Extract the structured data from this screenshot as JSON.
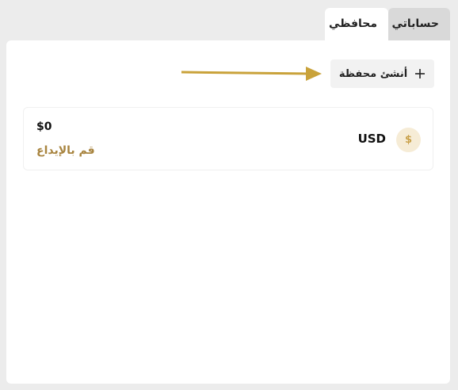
{
  "tabs": [
    {
      "label": "حساباتي",
      "active": false
    },
    {
      "label": "محافظي",
      "active": true
    }
  ],
  "toolbar": {
    "create_wallet_label": "أنشئ محفظة",
    "create_icon": "plus-icon",
    "pointer_icon": "arrow-right-icon"
  },
  "wallets": [
    {
      "currency": "USD",
      "icon_symbol": "$",
      "balance": "$0",
      "deposit_label": "قم بالإيداع"
    }
  ],
  "colors": {
    "accent": "#c9a14a",
    "deposit_text": "#a8843f",
    "coin_bg": "#f6ecd6",
    "arrow": "#c9a23a",
    "inactive_tab": "#d9d9d9",
    "page_bg": "#ececec"
  }
}
